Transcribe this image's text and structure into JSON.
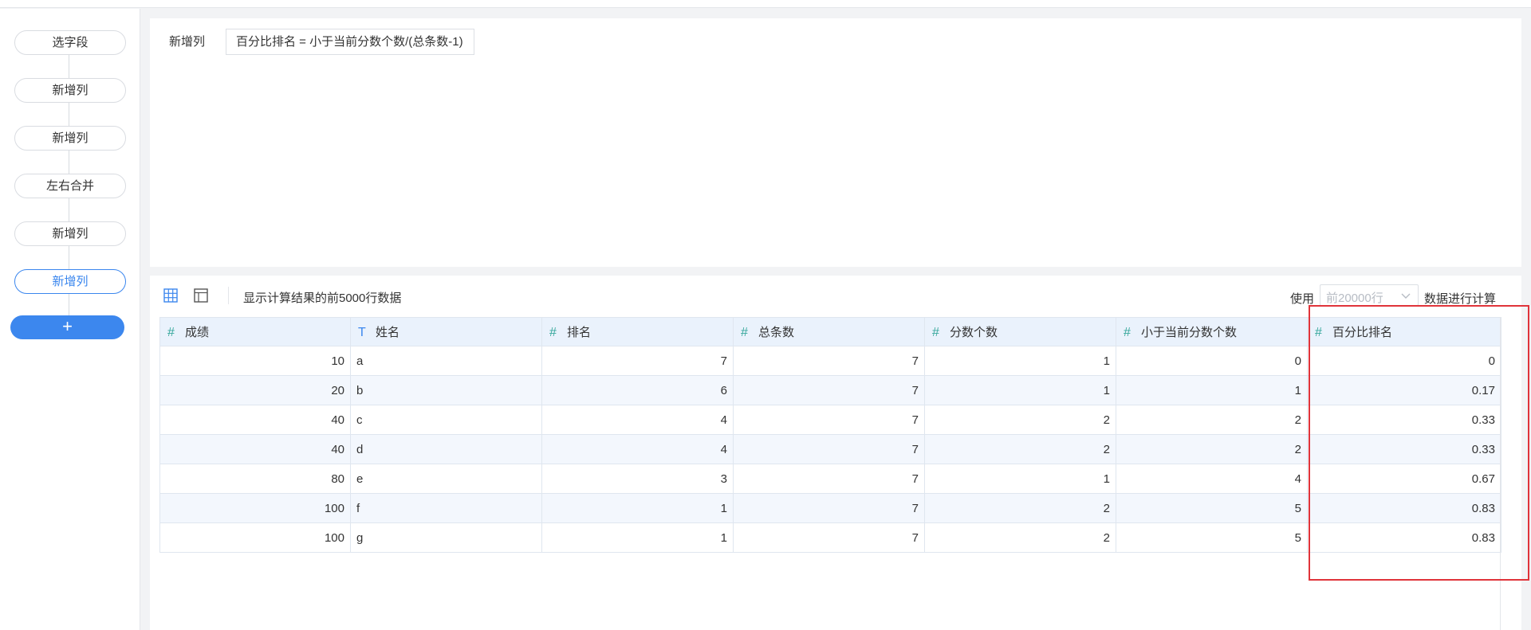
{
  "pipeline": {
    "steps": [
      {
        "label": "选字段",
        "active": false
      },
      {
        "label": "新增列",
        "active": false
      },
      {
        "label": "新增列",
        "active": false
      },
      {
        "label": "左右合并",
        "active": false
      },
      {
        "label": "新增列",
        "active": false
      },
      {
        "label": "新增列",
        "active": true
      }
    ],
    "add_label": "+"
  },
  "formula": {
    "label": "新增列",
    "expression": "百分比排名 = 小于当前分数个数/(总条数-1)"
  },
  "preview": {
    "description": "显示计算结果的前5000行数据",
    "use_label": "使用",
    "row_limit_placeholder": "前20000行",
    "calc_label": "数据进行计算"
  },
  "table": {
    "columns": [
      {
        "type_glyph": "#",
        "type": "number",
        "name": "成绩"
      },
      {
        "type_glyph": "T",
        "type": "text",
        "name": "姓名"
      },
      {
        "type_glyph": "#",
        "type": "number",
        "name": "排名"
      },
      {
        "type_glyph": "#",
        "type": "number",
        "name": "总条数"
      },
      {
        "type_glyph": "#",
        "type": "number",
        "name": "分数个数"
      },
      {
        "type_glyph": "#",
        "type": "number",
        "name": "小于当前分数个数"
      },
      {
        "type_glyph": "#",
        "type": "number",
        "name": "百分比排名"
      }
    ],
    "rows": [
      [
        "10",
        "a",
        "7",
        "7",
        "1",
        "0",
        "0"
      ],
      [
        "20",
        "b",
        "6",
        "7",
        "1",
        "1",
        "0.17"
      ],
      [
        "40",
        "c",
        "4",
        "7",
        "2",
        "2",
        "0.33"
      ],
      [
        "40",
        "d",
        "4",
        "7",
        "2",
        "2",
        "0.33"
      ],
      [
        "80",
        "e",
        "3",
        "7",
        "1",
        "4",
        "0.67"
      ],
      [
        "100",
        "f",
        "1",
        "7",
        "2",
        "5",
        "0.83"
      ],
      [
        "100",
        "g",
        "1",
        "7",
        "2",
        "5",
        "0.83"
      ]
    ]
  },
  "icons": {
    "grid_view": "grid-view-icon",
    "layout_view": "layout-view-icon",
    "select_caret": "chevron-down-icon"
  },
  "colors": {
    "accent": "#3c87ee",
    "highlight_border": "#e0343a",
    "number_type_icon": "#38a89d"
  }
}
